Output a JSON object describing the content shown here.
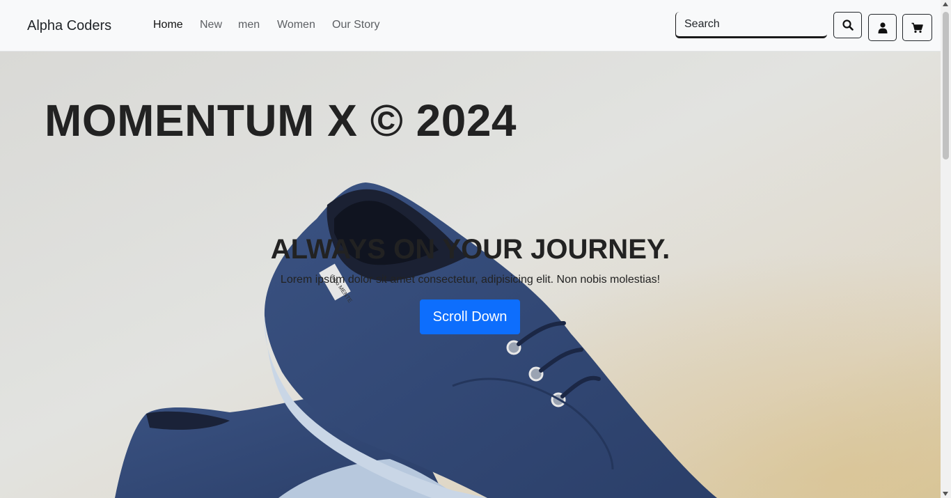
{
  "navbar": {
    "brand": "Alpha Coders",
    "links": [
      {
        "label": "Home",
        "active": true
      },
      {
        "label": "New",
        "active": false
      },
      {
        "label": "men",
        "active": false
      },
      {
        "label": "Women",
        "active": false
      },
      {
        "label": "Our Story",
        "active": false
      }
    ],
    "search": {
      "placeholder": "Search",
      "value": ""
    },
    "icons": [
      "search-icon",
      "user-icon",
      "cart-icon"
    ]
  },
  "hero": {
    "title": "MOMENTUM X © 2024",
    "tagline": "ALWAYS ON YOUR JOURNEY.",
    "lead": "Lorem ipsum dolor sit amet consectetur, adipisicing elit. Non nobis molestias!",
    "button_label": "Scroll Down",
    "shoe_tag": "duuo\nMENTE"
  },
  "colors": {
    "accent": "#0d6efd",
    "navbar_bg": "#f8f9fa",
    "shoe": "#2f4676"
  }
}
